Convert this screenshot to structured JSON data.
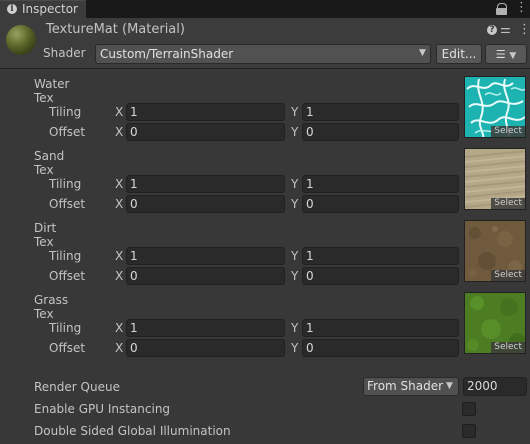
{
  "tab": {
    "label": "Inspector"
  },
  "header": {
    "title": "TextureMat (Material)",
    "shader_label": "Shader",
    "shader_value": "Custom/TerrainShader",
    "edit_label": "Edit..."
  },
  "textures": [
    {
      "label": "Water Tex",
      "tiling_x": "1",
      "tiling_y": "1",
      "offset_x": "0",
      "offset_y": "0",
      "select": "Select"
    },
    {
      "label": "Sand Tex",
      "tiling_x": "1",
      "tiling_y": "1",
      "offset_x": "0",
      "offset_y": "0",
      "select": "Select"
    },
    {
      "label": "Dirt Tex",
      "tiling_x": "1",
      "tiling_y": "1",
      "offset_x": "0",
      "offset_y": "0",
      "select": "Select"
    },
    {
      "label": "Grass Tex",
      "tiling_x": "1",
      "tiling_y": "1",
      "offset_x": "0",
      "offset_y": "0",
      "select": "Select"
    }
  ],
  "labels": {
    "tiling": "Tiling",
    "offset": "Offset",
    "x": "X",
    "y": "Y"
  },
  "render_queue": {
    "label": "Render Queue",
    "mode": "From Shader",
    "value": "2000"
  },
  "gpu_instancing": {
    "label": "Enable GPU Instancing",
    "checked": false
  },
  "double_sided_gi": {
    "label": "Double Sided Global Illumination",
    "checked": false
  },
  "icons": {
    "tab": "info-icon",
    "lock": "lock-icon",
    "tab_menu": "kebab-menu-icon",
    "material": "material-sphere-icon",
    "help": "help-icon",
    "preset": "sliders-icon",
    "more": "kebab-menu-icon",
    "dropdown": "caret-down-icon",
    "list": "list-icon"
  },
  "colors": {
    "background": "#383838",
    "field": "#2a2a2a",
    "text": "#c4c4c4"
  }
}
